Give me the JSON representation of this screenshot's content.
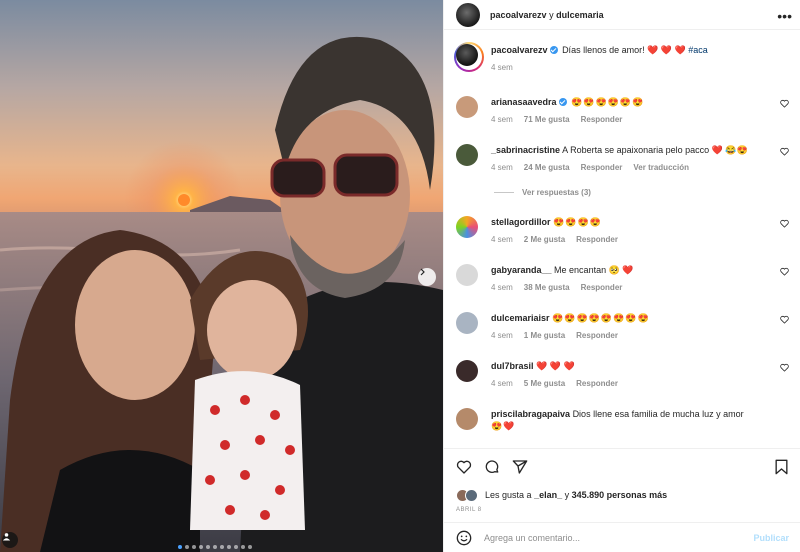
{
  "colors": {
    "accent": "#0095f6",
    "like": "#ed4956",
    "muted": "#8e8e8e",
    "text": "#262626"
  },
  "header": {
    "user1": "pacoalvarezv",
    "separator": "y",
    "user2": "dulcemaria",
    "more_icon": "more-horizontal-icon"
  },
  "carousel": {
    "slide_count": 11,
    "active_slide": 1
  },
  "caption": {
    "user": "pacoalvarezv",
    "text": "Días llenos de amor!",
    "emojis": "❤️ ❤️ ❤️",
    "hashtag": "#aca",
    "time": "4 sem"
  },
  "comments": [
    {
      "user": "arianasaavedra",
      "verified": true,
      "text": "😍😍😍😍😍😍",
      "time": "4 sem",
      "likes": "71 Me gusta",
      "reply": "Responder",
      "avatar_color": "#c89a7a"
    },
    {
      "user": "_sabrinacristine",
      "text": "A Roberta se apaixonaria pelo pacco ❤️ 😂😍",
      "time": "4 sem",
      "likes": "24 Me gusta",
      "reply": "Responder",
      "translate": "Ver traducción",
      "avatar_color": "#4a5a3a"
    },
    {
      "user": "stellagordillor",
      "text": "😍😍😍😍",
      "time": "4 sem",
      "likes": "2 Me gusta",
      "reply": "Responder",
      "avatar_color": "#f5a623"
    },
    {
      "user": "gabyaranda__",
      "text": "Me encantan 🥺 ❤️",
      "time": "4 sem",
      "likes": "38 Me gusta",
      "reply": "Responder",
      "avatar_color": "#d9d9d9"
    },
    {
      "user": "dulcemariaisr",
      "text": "😍😍😍😍😍😍😍😍",
      "time": "4 sem",
      "likes": "1 Me gusta",
      "reply": "Responder",
      "avatar_color": "#a9b4c2"
    },
    {
      "user": "dul7brasil",
      "text": "❤️ ❤️ ❤️",
      "time": "4 sem",
      "likes": "5 Me gusta",
      "reply": "Responder",
      "avatar_color": "#3a2a2a"
    },
    {
      "user": "priscilabragapaiva",
      "text": "Dios llene esa familia de mucha luz y amor",
      "text2": "😍❤️",
      "avatar_color": "#b58a6a"
    }
  ],
  "view_replies": "Ver respuestas (3)",
  "likes": {
    "prefix": "Les gusta a",
    "user": "_elan_",
    "connector": "y",
    "count": "345.890 personas más"
  },
  "date": "ABRIL 8",
  "add_comment": {
    "placeholder": "Agrega un comentario...",
    "publish": "Publicar"
  }
}
